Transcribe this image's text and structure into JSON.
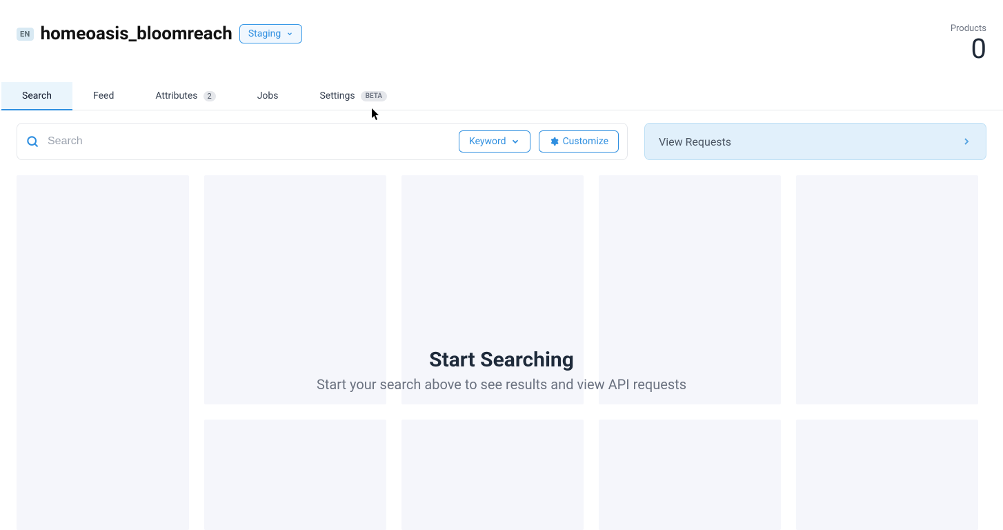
{
  "header": {
    "lang_code": "EN",
    "app_name": "homeoasis_bloomreach",
    "env_label": "Staging",
    "products_label": "Products",
    "products_count": "0"
  },
  "tabs": [
    {
      "label": "Search",
      "active": true
    },
    {
      "label": "Feed",
      "active": false
    },
    {
      "label": "Attributes",
      "active": false,
      "count": "2"
    },
    {
      "label": "Jobs",
      "active": false
    },
    {
      "label": "Settings",
      "active": false,
      "beta": "BETA"
    }
  ],
  "search": {
    "placeholder": "Search",
    "value": "",
    "keyword_button": "Keyword",
    "customize_button": "Customize"
  },
  "requests_panel": {
    "label": "View Requests"
  },
  "empty_state": {
    "title": "Start Searching",
    "subtitle": "Start your search above to see results and view API requests"
  }
}
